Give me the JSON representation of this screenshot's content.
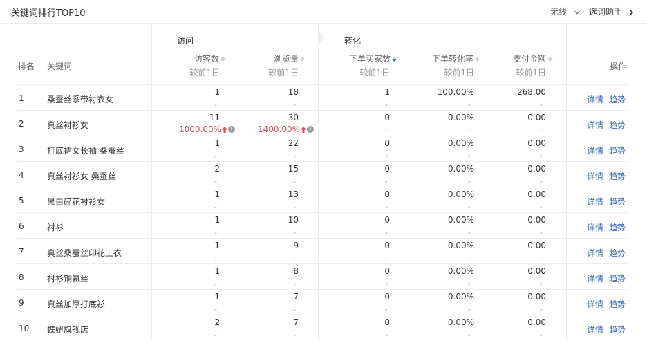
{
  "header": {
    "title": "关键词排行TOP10",
    "device_select": "无线",
    "helper_link": "选词助手"
  },
  "groups": {
    "visit": "访问",
    "conversion": "转化"
  },
  "columns": {
    "rank": "排名",
    "keyword": "关键词",
    "visitors": "访客数",
    "views": "浏览量",
    "buyers": "下单买家数",
    "conv_rate": "下单转化率",
    "payment": "支付金额",
    "action": "操作",
    "compare_label": "较前1日"
  },
  "rows": [
    {
      "rank": "1",
      "keyword": "桑蚕丝系带衬衣女",
      "visitors": "1",
      "views": "18",
      "buyers": "1",
      "conv_rate": "100.00%",
      "payment": "268.00",
      "sub": "-",
      "detail": "详情",
      "trend": "趋势"
    },
    {
      "rank": "2",
      "keyword": "真丝衬衫女",
      "visitors": "11",
      "views": "30",
      "buyers": "0",
      "conv_rate": "0.00%",
      "payment": "0.00",
      "visitors_change": "1000.00%",
      "views_change": "1400.00%",
      "sub": "-",
      "detail": "详情",
      "trend": "趋势"
    },
    {
      "rank": "3",
      "keyword": "打底裙女长袖 桑蚕丝",
      "visitors": "1",
      "views": "22",
      "buyers": "0",
      "conv_rate": "0.00%",
      "payment": "0.00",
      "sub": "-",
      "detail": "详情",
      "trend": "趋势"
    },
    {
      "rank": "4",
      "keyword": "真丝衬衫女 桑蚕丝",
      "visitors": "2",
      "views": "15",
      "buyers": "0",
      "conv_rate": "0.00%",
      "payment": "0.00",
      "sub": "-",
      "detail": "详情",
      "trend": "趋势"
    },
    {
      "rank": "5",
      "keyword": "黑白碎花衬衫女",
      "visitors": "1",
      "views": "13",
      "buyers": "0",
      "conv_rate": "0.00%",
      "payment": "0.00",
      "sub": "-",
      "detail": "详情",
      "trend": "趋势"
    },
    {
      "rank": "6",
      "keyword": "衬衫",
      "visitors": "1",
      "views": "10",
      "buyers": "0",
      "conv_rate": "0.00%",
      "payment": "0.00",
      "sub": "-",
      "detail": "详情",
      "trend": "趋势"
    },
    {
      "rank": "7",
      "keyword": "真丝桑蚕丝印花上衣",
      "visitors": "1",
      "views": "9",
      "buyers": "0",
      "conv_rate": "0.00%",
      "payment": "0.00",
      "sub": "-",
      "detail": "详情",
      "trend": "趋势"
    },
    {
      "rank": "8",
      "keyword": "衬衫铜氨丝",
      "visitors": "1",
      "views": "8",
      "buyers": "0",
      "conv_rate": "0.00%",
      "payment": "0.00",
      "sub": "-",
      "detail": "详情",
      "trend": "趋势"
    },
    {
      "rank": "9",
      "keyword": "真丝加厚打底衫",
      "visitors": "1",
      "views": "7",
      "buyers": "0",
      "conv_rate": "0.00%",
      "payment": "0.00",
      "sub": "-",
      "detail": "详情",
      "trend": "趋势"
    },
    {
      "rank": "10",
      "keyword": "蝶妞旗舰店",
      "visitors": "2",
      "views": "7",
      "buyers": "0",
      "conv_rate": "0.00%",
      "payment": "0.00",
      "sub": "-",
      "detail": "详情",
      "trend": "趋势"
    }
  ],
  "colors": {
    "link": "#3a6ec3",
    "increase": "#e8424c",
    "sort_active": "#3a6ec3",
    "sort_idle": "#c6d3e6"
  },
  "icons": {
    "sort": "sort-diamond-icon",
    "increase": "arrow-up-icon",
    "info": "info-circle-icon"
  }
}
